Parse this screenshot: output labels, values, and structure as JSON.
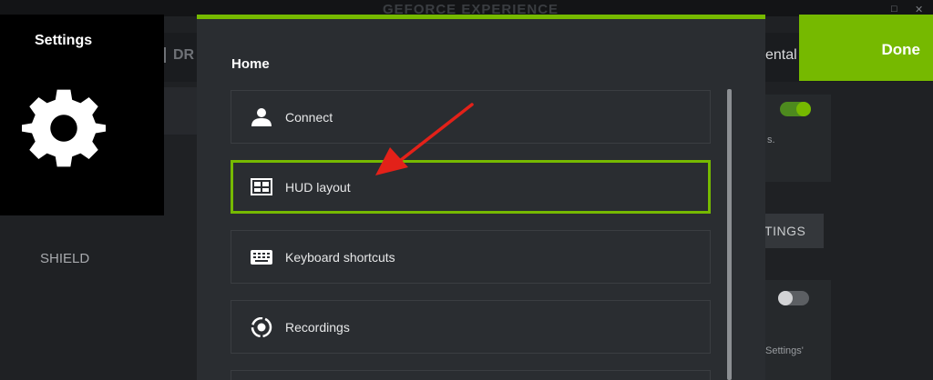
{
  "app": {
    "brand": "GEFORCE EXPERIENCE",
    "tab_partial_left": "DR",
    "tab_partial_right": "ental",
    "sidebar_item": "SHIELD",
    "settings_button_partial": "TTINGS",
    "text_fragment_1": "s.",
    "text_fragment_2": "Settings'"
  },
  "flyout": {
    "title": "Settings",
    "icon": "gear-icon"
  },
  "panel": {
    "title": "Home",
    "items": [
      {
        "label": "Connect",
        "icon": "person-icon",
        "selected": false
      },
      {
        "label": "HUD layout",
        "icon": "hud-layout-icon",
        "selected": true
      },
      {
        "label": "Keyboard shortcuts",
        "icon": "keyboard-icon",
        "selected": false
      },
      {
        "label": "Recordings",
        "icon": "recordings-icon",
        "selected": false
      }
    ]
  },
  "done_label": "Done",
  "colors": {
    "accent": "#76b900",
    "panel_bg": "#2a2d31",
    "annotation_arrow": "#e32119"
  }
}
